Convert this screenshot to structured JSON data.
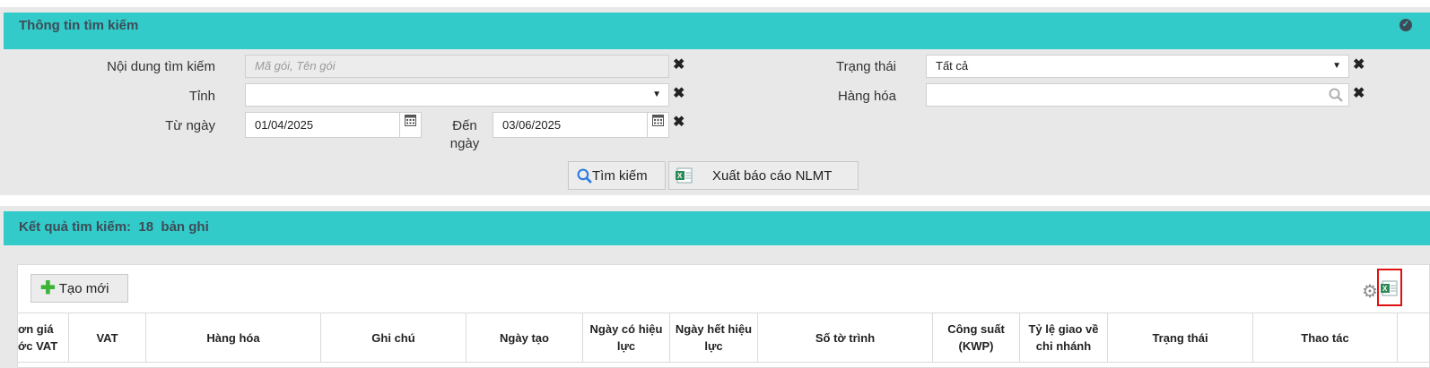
{
  "search_panel": {
    "title": "Thông tin tìm kiếm",
    "content_label": "Nội dung tìm kiếm",
    "content_placeholder": "Mã gói, Tên gói",
    "province_label": "Tỉnh",
    "province_value": "",
    "from_label": "Từ ngày",
    "from_value": "01/04/2025",
    "to_label": "Đến ngày",
    "to_value": "03/06/2025",
    "status_label": "Trạng thái",
    "status_value": "Tất cả",
    "goods_label": "Hàng hóa",
    "goods_value": "",
    "search_button": "Tìm kiếm",
    "export_button": "Xuất báo cáo NLMT"
  },
  "results_panel": {
    "title": "Kết quả tìm kiếm:",
    "count": "18",
    "count_unit": "bản ghi",
    "create_button": "Tạo mới"
  },
  "table": {
    "columns": [
      "ơn giá ớc VAT",
      "VAT",
      "Hàng hóa",
      "Ghi chú",
      "Ngày tạo",
      "Ngày có hiệu lực",
      "Ngày hết hiệu lực",
      "Số tờ trình",
      "Công suất (KWP)",
      "Tỷ lệ giao về chi nhánh",
      "Trạng thái",
      "Thao tác"
    ]
  },
  "colors": {
    "teal": "#33cbc9",
    "highlight": "#e01010"
  }
}
